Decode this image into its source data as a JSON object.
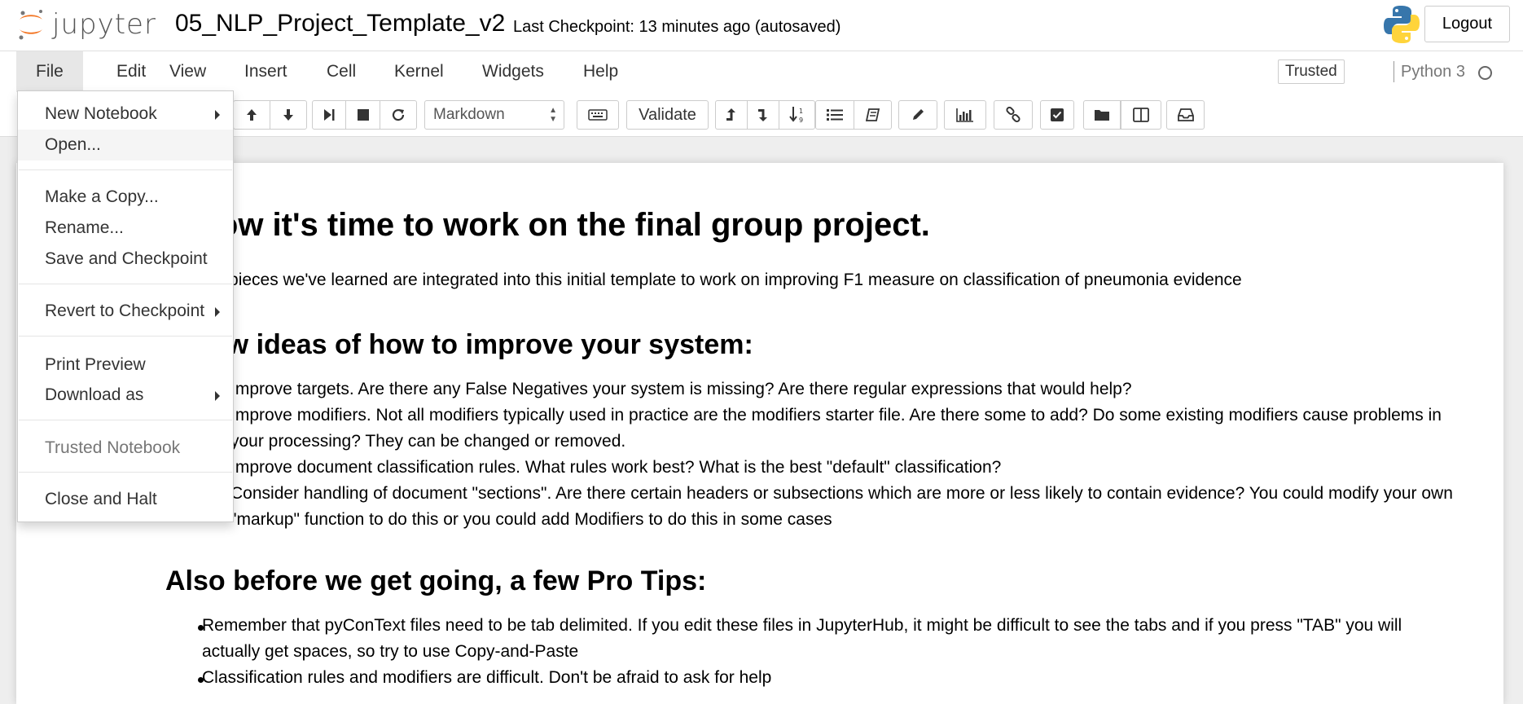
{
  "header": {
    "logo_text": "jupyter",
    "notebook_name": "05_NLP_Project_Template_v2",
    "checkpoint": "Last Checkpoint: 13 minutes ago (autosaved)",
    "logout_label": "Logout"
  },
  "menubar": {
    "items": [
      "File",
      "Edit",
      "View",
      "Insert",
      "Cell",
      "Kernel",
      "Widgets",
      "Help"
    ],
    "open_menu": "File",
    "trusted_label": "Trusted",
    "kernel_name": "Python 3"
  },
  "toolbar": {
    "cell_type": "Markdown",
    "validate_label": "Validate"
  },
  "file_menu": {
    "new_notebook": "New Notebook",
    "open": "Open...",
    "make_copy": "Make a Copy...",
    "rename": "Rename...",
    "save_checkpoint": "Save and Checkpoint",
    "revert": "Revert to Checkpoint",
    "print_preview": "Print Preview",
    "download_as": "Download as",
    "trusted_notebook": "Trusted Notebook",
    "close_halt": "Close and Halt"
  },
  "notebook": {
    "heading1": "Now it's time to work on the final group project.",
    "intro": "The pieces we've learned are integrated into this initial template to work on improving F1 measure on classification of pneumonia evidence",
    "heading2": "Few ideas of how to improve your system:",
    "ideas": [
      "Improve targets. Are there any False Negatives your system is missing? Are there regular expressions that would help?",
      "Improve modifiers. Not all modifiers typically used in practice are the modifiers starter file. Are there some to add? Do some existing modifiers cause problems in your processing? They can be changed or removed.",
      "Improve document classification rules. What rules work best? What is the best \"default\" classification?",
      "Consider handling of document \"sections\". Are there certain headers or subsections which are more or less likely to contain evidence? You could modify your own \"markup\" function to do this or you could add Modifiers to do this in some cases"
    ],
    "heading3": "Also before we get going, a few Pro Tips:",
    "tips": [
      "Remember that pyConText files need to be tab delimited. If you edit these files in JupyterHub, it might be difficult to see the tabs and if you press \"TAB\" you will actually get spaces, so try to use Copy-and-Paste",
      "Classification rules and modifiers are difficult. Don't be afraid to ask for help"
    ]
  },
  "colors": {
    "jupyter_orange": "#F37726",
    "menu_open_bg": "#e7e7e7",
    "python_blue": "#3776AB",
    "python_yellow": "#FFD43B"
  },
  "icons": [
    "jupyter-logo-icon",
    "python-logo-icon",
    "arrow-up-icon",
    "arrow-down-icon",
    "run-icon",
    "stop-icon",
    "restart-icon",
    "keyboard-icon",
    "move-up-icon",
    "move-down-icon",
    "sort-numeric-icon",
    "list-icon",
    "book-icon",
    "pencil-icon",
    "bar-chart-icon",
    "link-icon",
    "check-square-icon",
    "folder-icon",
    "columns-icon",
    "inbox-icon",
    "caret-right-icon",
    "kernel-idle-icon"
  ]
}
